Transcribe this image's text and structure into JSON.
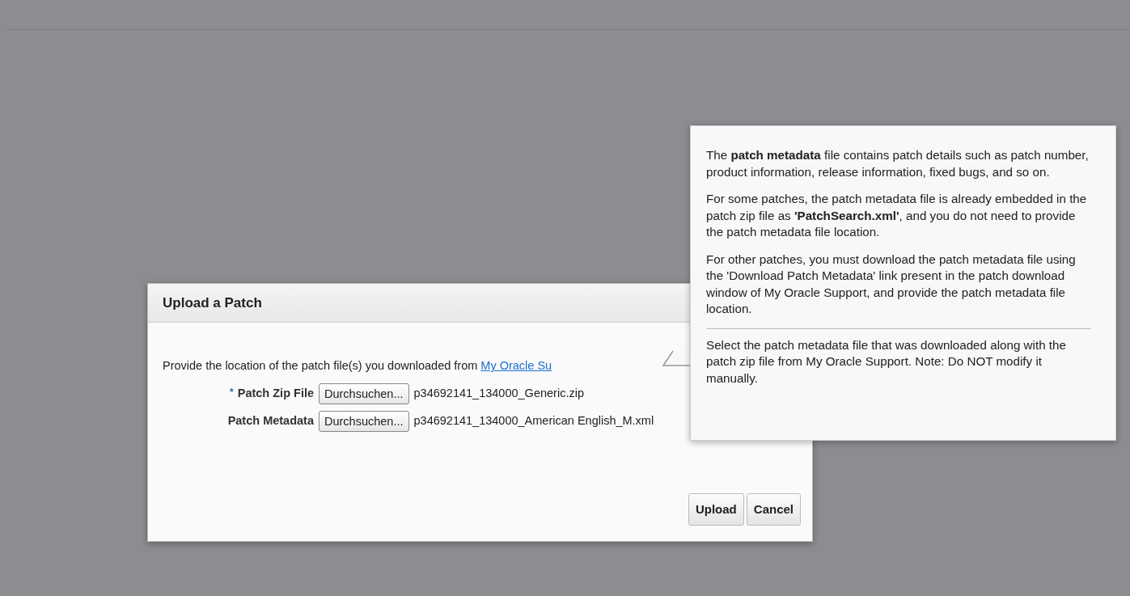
{
  "dialog": {
    "title": "Upload a Patch",
    "instruction": "Provide the location of the patch file(s) you downloaded from",
    "instruction_link": "My Oracle Su",
    "fields": [
      {
        "required_mark": "*",
        "label": "Patch Zip File",
        "button": "Durchsuchen...",
        "file": "p34692141_134000_Generic.zip"
      },
      {
        "label": "Patch Metadata",
        "button": "Durchsuchen...",
        "file": "p34692141_134000_American English_M.xml"
      }
    ],
    "buttons": [
      "Upload",
      "Cancel"
    ]
  },
  "tooltip": {
    "paragraphs": [
      "The **patch metadata** file contains patch details such as patch number, product information, release information, fixed bugs, and so on.",
      "For some patches, the patch metadata file is already embedded in the patch zip file as **'PatchSearch.xml'**, and you do not need to provide the patch metadata file location.",
      "For other patches, you must download the patch metadata file using the 'Download Patch Metadata' link present in the patch download window of My Oracle Support, and provide the patch metadata file location."
    ],
    "note": "Select the patch metadata file that was downloaded along with the patch zip file from My Oracle Support. Note: Do NOT modify it manually."
  }
}
